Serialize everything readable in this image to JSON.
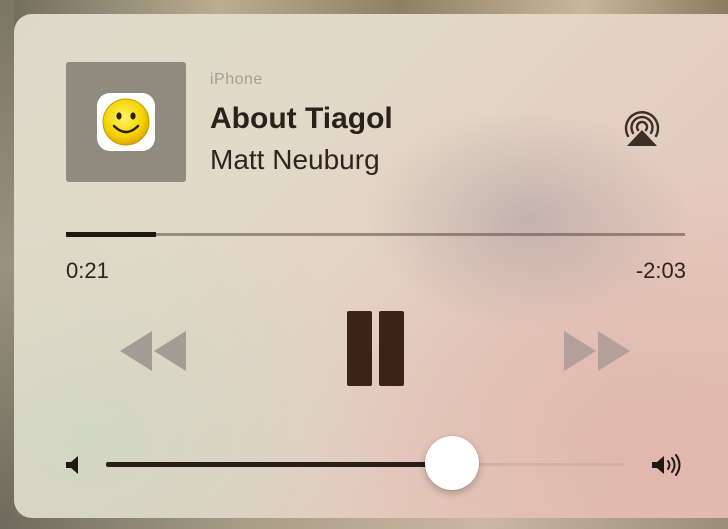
{
  "now_playing": {
    "device": "iPhone",
    "title": "About Tiagol",
    "artist": "Matt Neuburg",
    "artwork_icon": "smiley-icon"
  },
  "progress": {
    "elapsed": "0:21",
    "remaining": "-2:03",
    "fraction": 0.146
  },
  "controls": {
    "rewind_icon": "rewind-icon",
    "pause_icon": "pause-icon",
    "forward_icon": "fast-forward-icon",
    "airplay_icon": "airplay-icon",
    "state": "playing"
  },
  "volume": {
    "level": 0.667,
    "min_icon": "speaker-low-icon",
    "max_icon": "speaker-high-icon"
  },
  "colors": {
    "primary_text": "#2a211b",
    "secondary_text": "#a39e8f",
    "control_active": "#3a2418",
    "control_inactive": "#a39c96"
  }
}
